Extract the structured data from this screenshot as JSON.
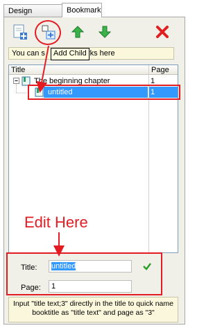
{
  "tabs": [
    {
      "label": "Design Setting"
    },
    {
      "label": "Bookmark"
    }
  ],
  "toolbar": {
    "add_sibling": "add-sibling-icon",
    "add_child": "add-child-icon",
    "move_up": "arrow-up-icon",
    "move_down": "arrow-down-icon",
    "delete": "delete-icon"
  },
  "hint_text": "You can s",
  "hint_text_tail": "rks here",
  "tooltip": "Add Child",
  "grid": {
    "columns": [
      "Title",
      "Page"
    ],
    "rows": [
      {
        "title": "The beginning chapter",
        "page": "1"
      },
      {
        "title": "untitled",
        "page": "1"
      }
    ]
  },
  "annotation": "Edit Here",
  "form": {
    "title_label": "Title:",
    "title_value": "untitled",
    "page_label": "Page:",
    "page_value": "1"
  },
  "info": "Input \"title text;3\" directly in the title to quick name booktitle as \"title text\" and page as \"3\"",
  "colors": {
    "accent": "#3399ff",
    "annotation": "#e31b23"
  }
}
